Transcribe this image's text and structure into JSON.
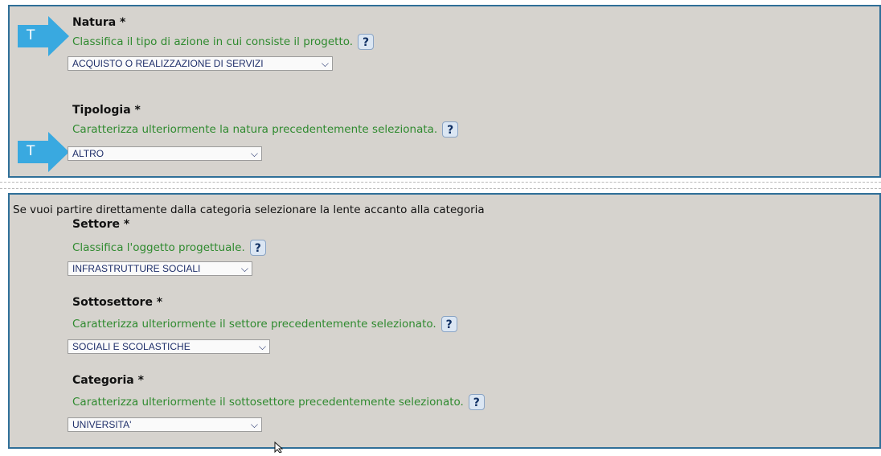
{
  "colors": {
    "panel_bg": "#d6d3ce",
    "panel_border": "#2f6f98",
    "help_text": "#2f8a2f",
    "arrow": "#39a9e0",
    "select_text": "#1f2f6a"
  },
  "badge_letter": "T",
  "help_icon_glyph": "?",
  "chevron_glyph": "⌵",
  "natura": {
    "label": "Natura *",
    "help": "Classifica il tipo di azione in cui consiste il progetto.",
    "value": "ACQUISTO O REALIZZAZIONE DI SERVIZI"
  },
  "tipologia": {
    "label": "Tipologia *",
    "help": "Caratterizza ulteriormente la natura precedentemente selezionata.",
    "value": "ALTRO"
  },
  "intro_text": "Se vuoi partire direttamente dalla categoria selezionare la lente accanto alla categoria",
  "settore": {
    "label": "Settore *",
    "help": "Classifica l'oggetto progettuale.",
    "value": "INFRASTRUTTURE SOCIALI"
  },
  "sottosettore": {
    "label": "Sottosettore *",
    "help": "Caratterizza ulteriormente il settore precedentemente selezionato.",
    "value": "SOCIALI E SCOLASTICHE"
  },
  "categoria": {
    "label": "Categoria *",
    "help": "Caratterizza ulteriormente il sottosettore precedentemente selezionato.",
    "value": "UNIVERSITA'"
  }
}
